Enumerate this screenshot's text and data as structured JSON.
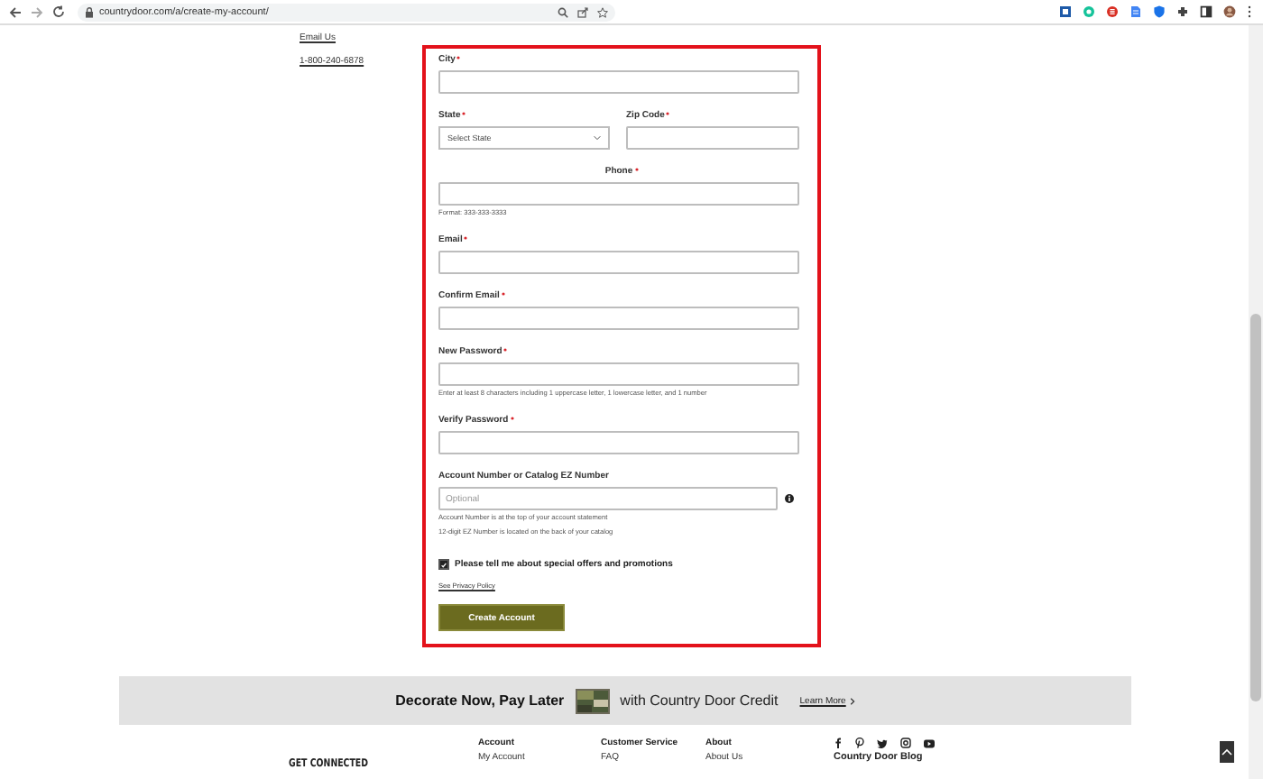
{
  "browser": {
    "url": "countrydoor.com/a/create-my-account/"
  },
  "sidebar_links": [
    "Email Us",
    "1-800-240-6878"
  ],
  "form": {
    "rows": [
      {
        "kind": "field",
        "label": "City",
        "required": true,
        "centered": false
      },
      {
        "kind": "pair",
        "fields": [
          {
            "kind": "select",
            "label": "State",
            "required": true,
            "value": "Select State"
          },
          {
            "kind": "field",
            "label": "Zip Code",
            "required": true
          }
        ]
      },
      {
        "kind": "field",
        "label": "Phone",
        "required": true,
        "centered": true,
        "hints": [
          "Format: 333-333-3333"
        ]
      },
      {
        "kind": "field",
        "label": "Email",
        "required": true,
        "centered": false
      },
      {
        "kind": "field",
        "label": "Confirm Email",
        "required": true,
        "centered": false
      },
      {
        "kind": "field",
        "label": "New Password",
        "required": true,
        "centered": false,
        "hints": [
          "Enter at least 8 characters including 1 uppercase letter, 1 lowercase letter, and 1 number"
        ]
      },
      {
        "kind": "field",
        "label": "Verify Password",
        "required": true,
        "centered": false
      },
      {
        "kind": "field",
        "label": "Account Number or Catalog EZ Number",
        "required": false,
        "centered": false,
        "placeholder": "Optional",
        "info": true,
        "hints": [
          "Account Number is at the top of your account statement",
          "12-digit EZ Number is located on the back of your catalog"
        ]
      },
      {
        "kind": "checkbox",
        "label": "Please tell me about special offers and promotions",
        "checked": true
      },
      {
        "kind": "link",
        "label": "See Privacy Policy"
      },
      {
        "kind": "button",
        "label": "Create Account"
      }
    ]
  },
  "banner": {
    "headline": "Decorate Now, Pay Later",
    "text": "with Country Door Credit",
    "link": "Learn More"
  },
  "footer": {
    "heading": "GET CONNECTED",
    "columns": [
      {
        "title": "Account",
        "items": [
          "My Account"
        ]
      },
      {
        "title": "Customer Service",
        "items": [
          "FAQ"
        ]
      },
      {
        "title": "About",
        "items": [
          "About Us"
        ]
      }
    ],
    "blog": "Country Door Blog"
  }
}
